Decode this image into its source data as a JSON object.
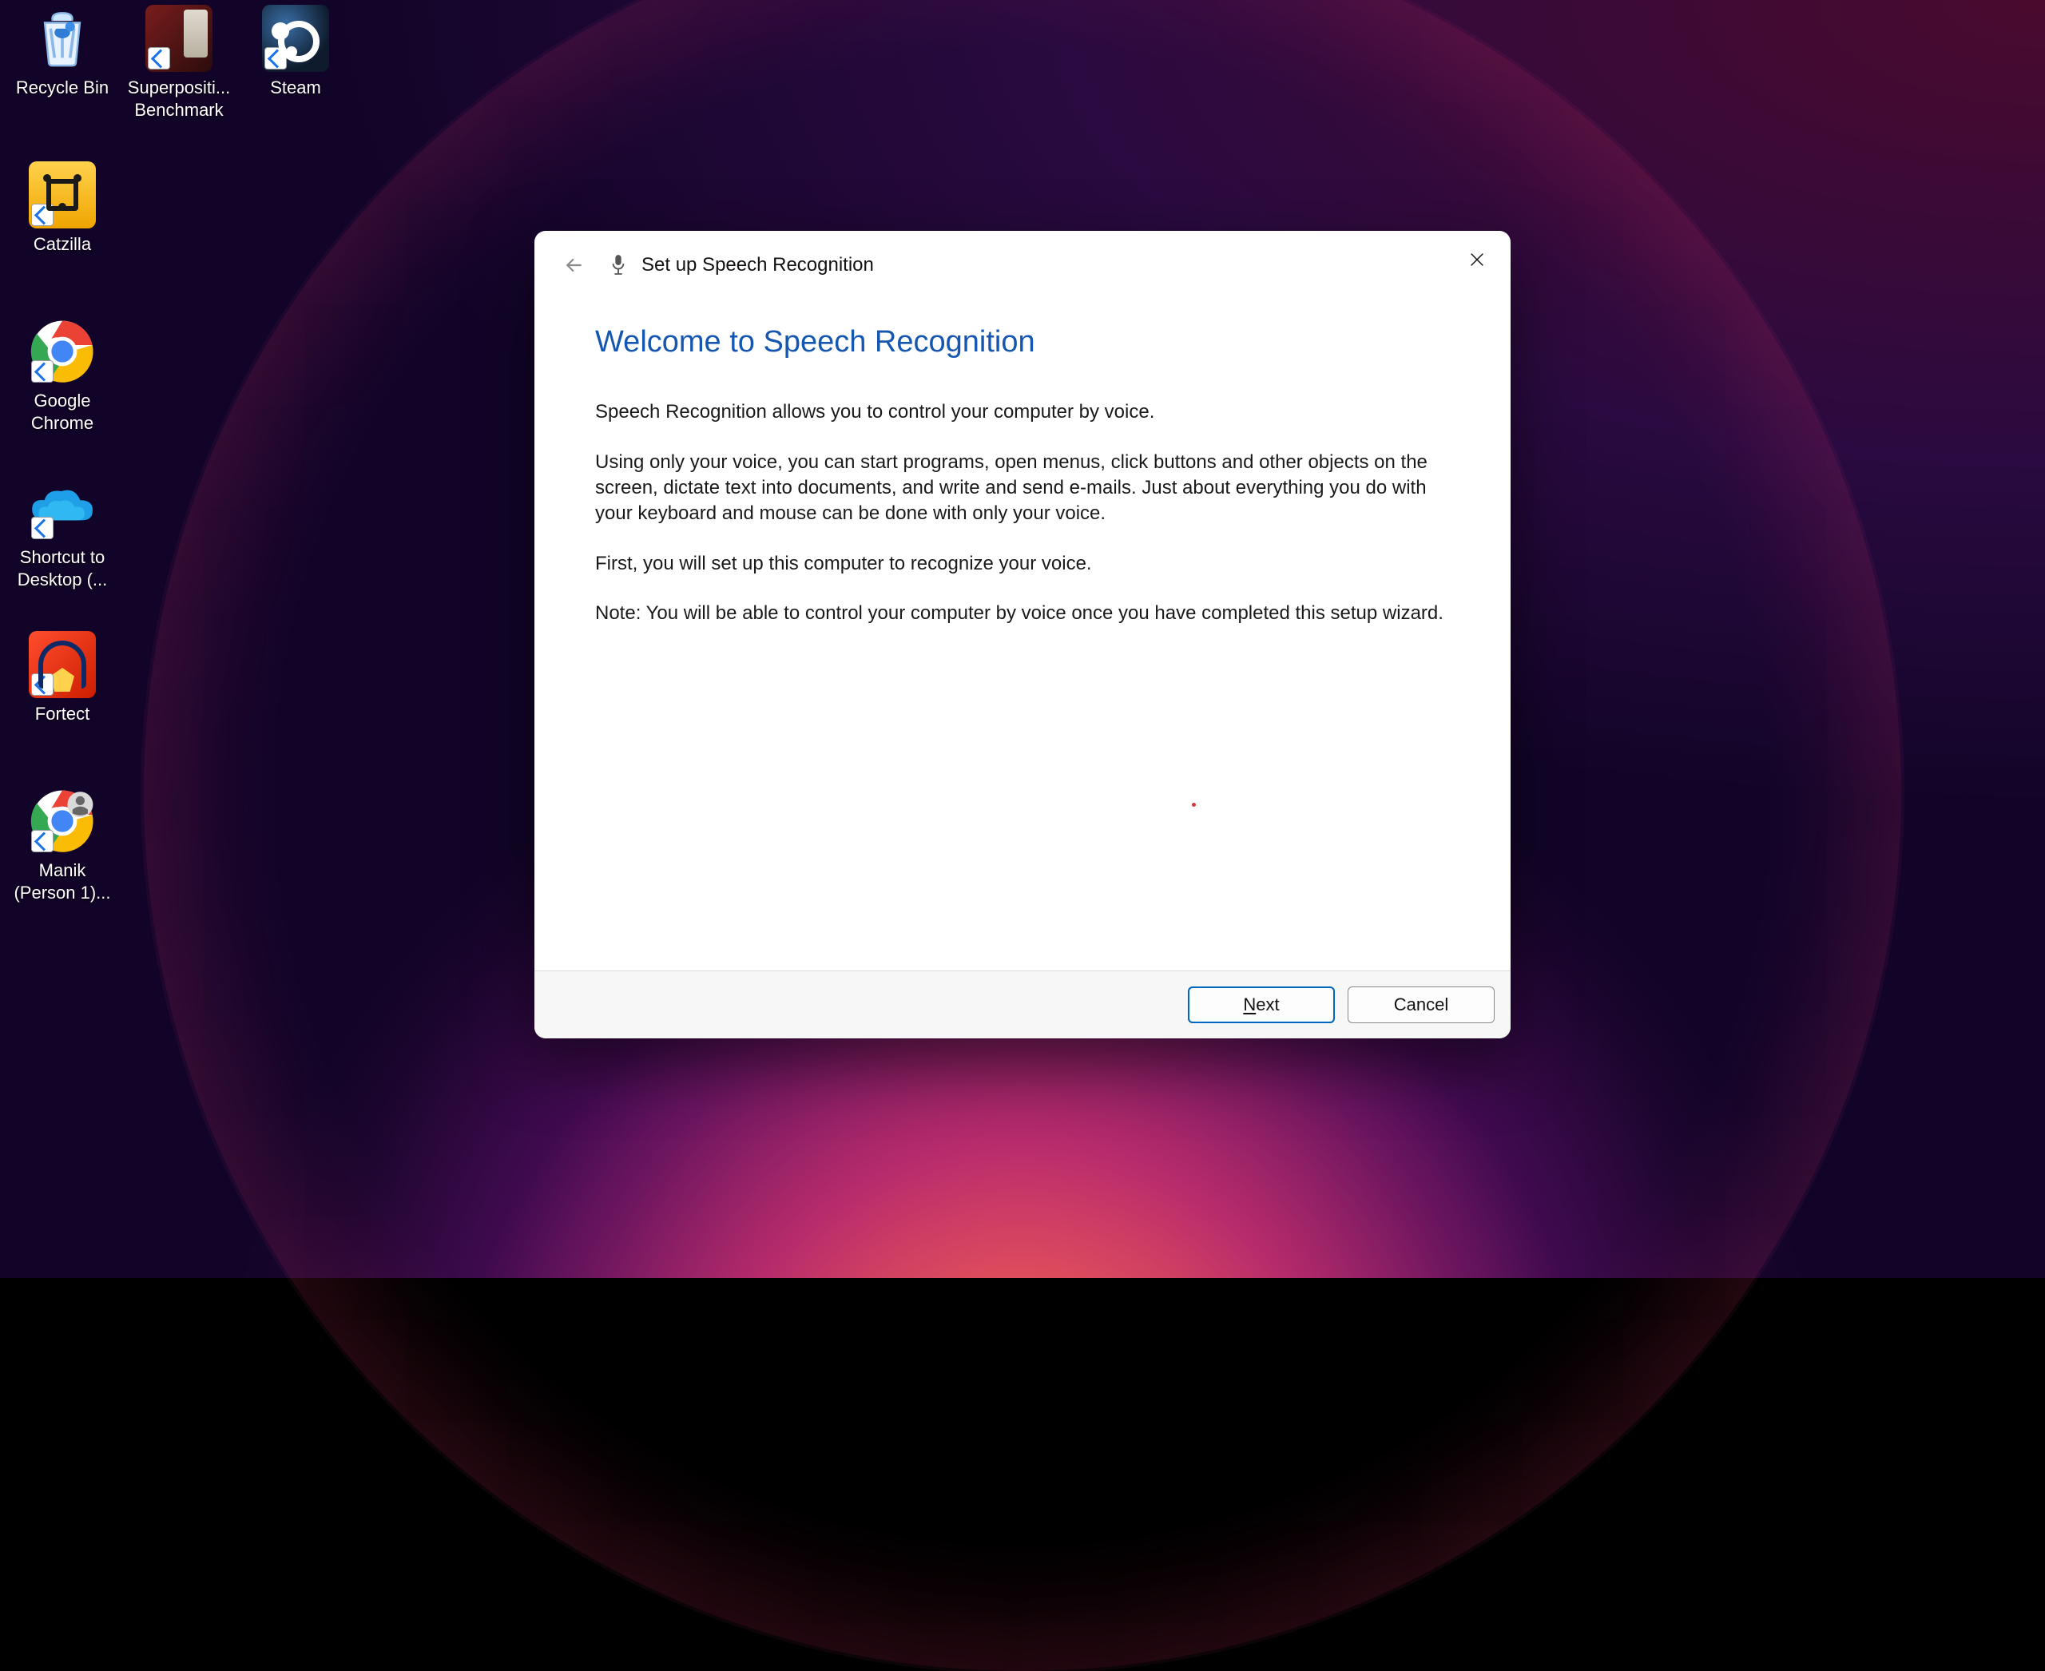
{
  "desktop": {
    "icons": [
      {
        "id": "recycle-bin",
        "label": "Recycle Bin",
        "label2": ""
      },
      {
        "id": "superposition",
        "label": "Superpositi...",
        "label2": "Benchmark"
      },
      {
        "id": "steam",
        "label": "Steam",
        "label2": ""
      },
      {
        "id": "catzilla",
        "label": "Catzilla",
        "label2": ""
      },
      {
        "id": "chrome",
        "label": "Google",
        "label2": "Chrome"
      },
      {
        "id": "onedrive",
        "label": "Shortcut to",
        "label2": "Desktop (..."
      },
      {
        "id": "fortect",
        "label": "Fortect",
        "label2": ""
      },
      {
        "id": "manik",
        "label": "Manik",
        "label2": "(Person 1)..."
      }
    ]
  },
  "dialog": {
    "title": "Set up Speech Recognition",
    "heading": "Welcome to Speech Recognition",
    "p1": "Speech Recognition allows you to control your computer by voice.",
    "p2": "Using only your voice, you can start programs, open menus, click buttons and other objects on the screen, dictate text into documents, and write and send e-mails. Just about everything you do with your keyboard and mouse can be done with only your voice.",
    "p3": "First, you will set up this computer to recognize your voice.",
    "p4": "Note: You will be able to control your computer by voice once you have completed this setup wizard.",
    "buttons": {
      "next_pre": "N",
      "next_post": "ext",
      "cancel": "Cancel"
    }
  }
}
